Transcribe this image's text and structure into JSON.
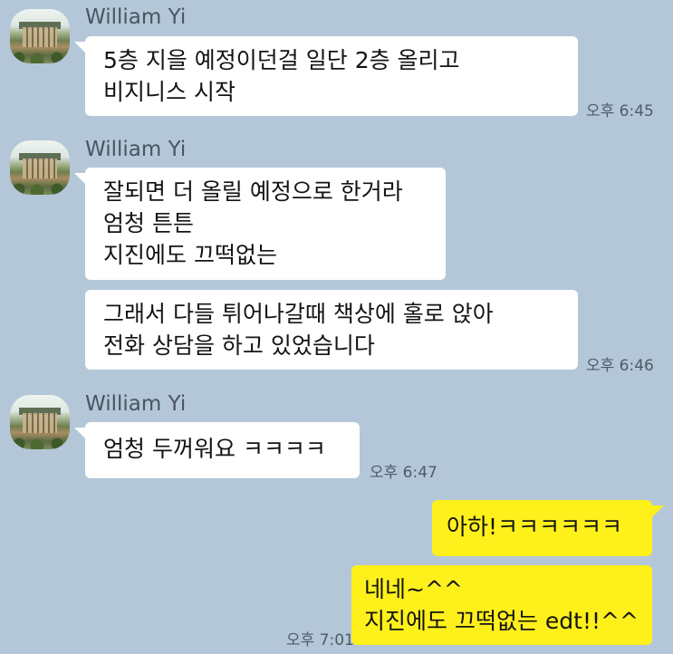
{
  "chat": {
    "sender_name": "William Yi",
    "messages": [
      {
        "lines": [
          "5층 지을 예정이던걸 일단 2층 올리고",
          "비지니스 시작"
        ],
        "time": "오후 6:45"
      },
      {
        "lines": [
          "잘되면 더 올릴 예정으로 한거라",
          "엄청 튼튼",
          "지진에도 끄떡없는"
        ]
      },
      {
        "lines": [
          "그래서 다들 튀어나갈때 책상에 홀로 앉아",
          "전화 상담을 하고 있었습니다"
        ],
        "time": "오후 6:46"
      },
      {
        "lines": [
          "엄청 두꺼워요 ㅋㅋㅋㅋ"
        ],
        "time": "오후 6:47"
      }
    ],
    "my_messages": [
      {
        "lines": [
          "아하!ㅋㅋㅋㅋㅋㅋ"
        ]
      },
      {
        "lines": [
          "네네~^^",
          "지진에도 끄떡없는 edt!!^^"
        ],
        "time": "오후 7:01"
      }
    ]
  },
  "colors": {
    "background": "#b3c7d9",
    "incoming_bubble": "#ffffff",
    "outgoing_bubble": "#fef01b"
  },
  "icons": {
    "avatar": "profile-photo-building"
  }
}
